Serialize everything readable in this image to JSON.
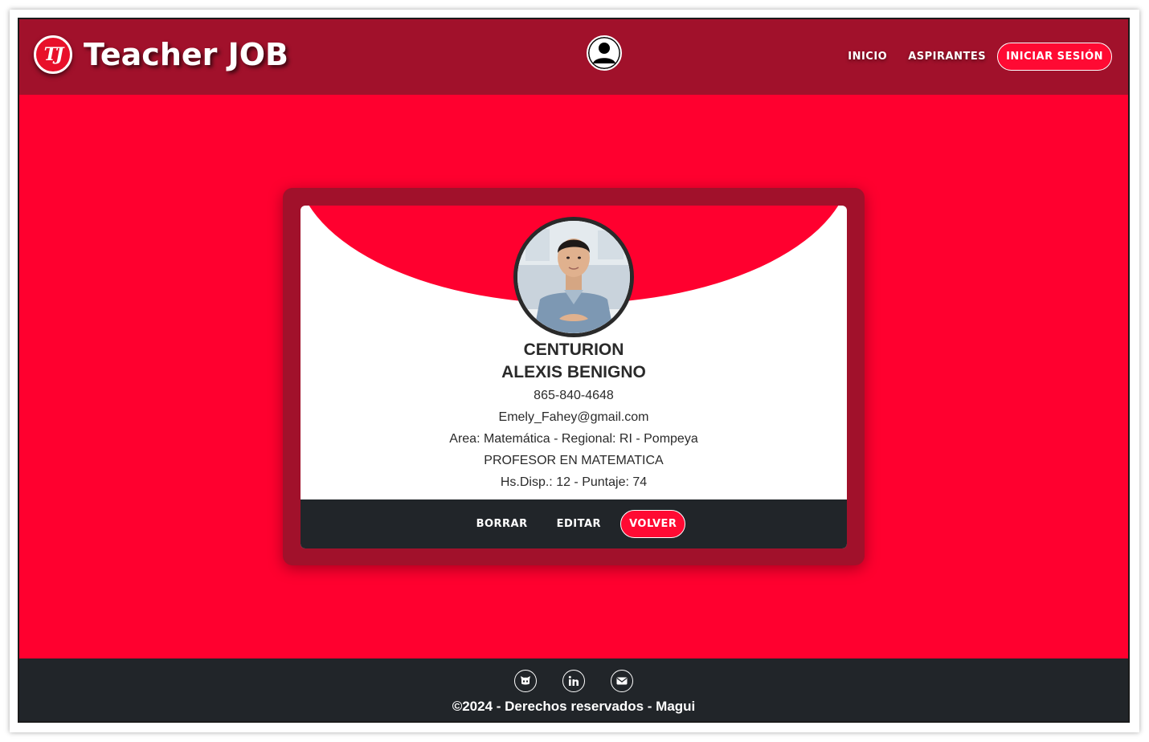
{
  "header": {
    "logo_badge": "TJ",
    "brand": "Teacher JOB",
    "nav": {
      "inicio": "INICIO",
      "aspirantes": "ASPIRANTES",
      "login": "INICIAR SESIÓN"
    }
  },
  "profile": {
    "last_name": "CENTURION",
    "first_name": "ALEXIS BENIGNO",
    "phone": "865-840-4648",
    "email": "Emely_Fahey@gmail.com",
    "area": "Area: Matemática - Regional: RI - Pompeya",
    "title": "PROFESOR EN MATEMATICA",
    "availability": "Hs.Disp.: 12 - Puntaje: 74"
  },
  "card_actions": {
    "delete": "BORRAR",
    "edit": "EDITAR",
    "back": "VOLVER"
  },
  "footer": {
    "social_icons": [
      "github-icon",
      "linkedin-icon",
      "email-icon"
    ],
    "copyright": "©2024 - Derechos reservados - Magui"
  },
  "colors": {
    "brand_dark": "#a1112b",
    "brand_red": "#ff002f",
    "footer_dark": "#212529"
  }
}
